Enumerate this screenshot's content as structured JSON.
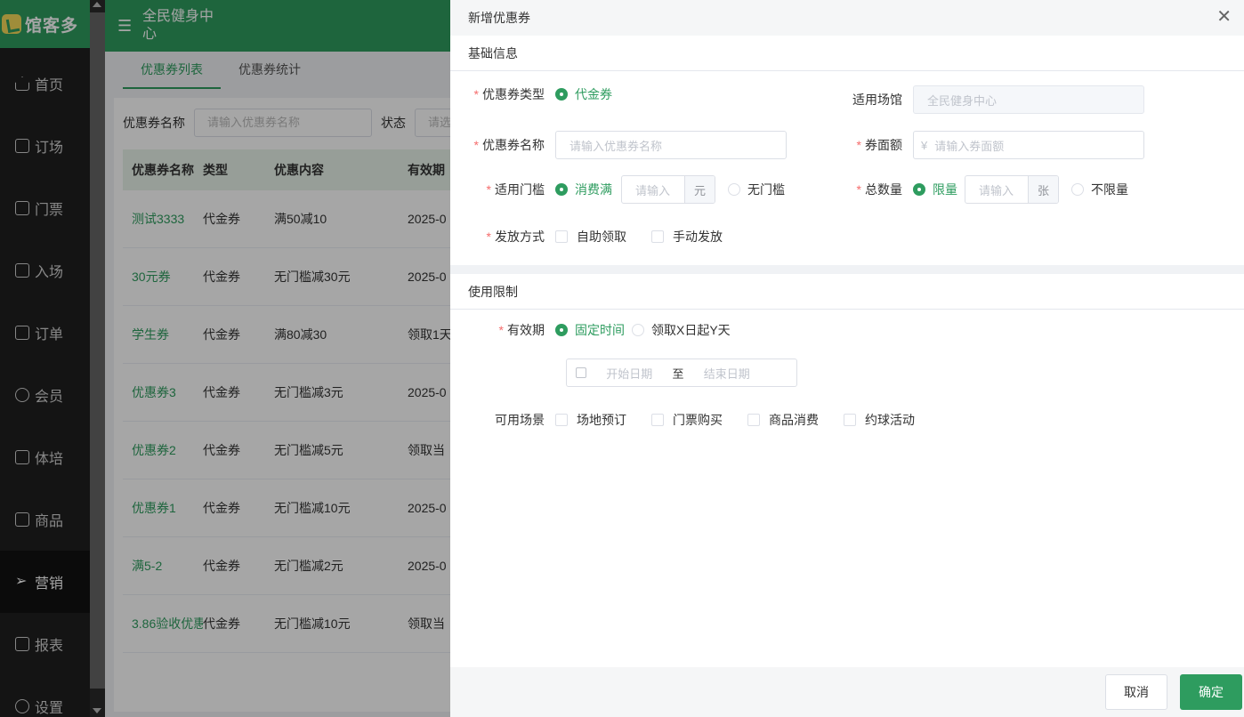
{
  "sidebar": {
    "logo": "馆客多",
    "items": [
      {
        "label": "首页"
      },
      {
        "label": "订场"
      },
      {
        "label": "门票"
      },
      {
        "label": "入场"
      },
      {
        "label": "订单"
      },
      {
        "label": "会员"
      },
      {
        "label": "体培"
      },
      {
        "label": "商品"
      },
      {
        "label": "营销"
      },
      {
        "label": "报表"
      },
      {
        "label": "设置"
      }
    ]
  },
  "header": {
    "venue": "全民健身中心"
  },
  "tabs": [
    {
      "label": "优惠券列表"
    },
    {
      "label": "优惠券统计"
    }
  ],
  "filter": {
    "name_label": "优惠券名称",
    "name_placeholder": "请输入优惠券名称",
    "status_label": "状态",
    "status_placeholder": "请选"
  },
  "table": {
    "headers": [
      "优惠券名称",
      "类型",
      "优惠内容",
      "有效期"
    ],
    "rows": [
      [
        "测试3333",
        "代金券",
        "满50减10",
        "2025-0"
      ],
      [
        "30元券",
        "代金券",
        "无门槛减30元",
        "2025-0"
      ],
      [
        "学生券",
        "代金券",
        "满80减30",
        "领取1天"
      ],
      [
        "优惠券3",
        "代金券",
        "无门槛减3元",
        "2025-0"
      ],
      [
        "优惠券2",
        "代金券",
        "无门槛减5元",
        "领取当"
      ],
      [
        "优惠券1",
        "代金券",
        "无门槛减10元",
        "2025-0"
      ],
      [
        "满5-2",
        "代金券",
        "无门槛减2元",
        "2025-0"
      ],
      [
        "3.86验收优惠",
        "代金券",
        "无门槛减10元",
        "领取当"
      ]
    ]
  },
  "drawer": {
    "title": "新增优惠券",
    "basic_section": "基础信息",
    "coupon_type_label": "优惠券类型",
    "coupon_type_value": "代金券",
    "venue_label": "适用场馆",
    "venue_value": "全民健身中心",
    "name_label": "优惠券名称",
    "name_placeholder": "请输入优惠券名称",
    "face_label": "券面额",
    "face_prefix": "¥",
    "face_placeholder": "请输入券面额",
    "threshold_label": "适用门槛",
    "threshold_on": "消费满",
    "threshold_placeholder": "请输入",
    "threshold_unit": "元",
    "threshold_off": "无门槛",
    "total_label": "总数量",
    "total_on": "限量",
    "total_placeholder": "请输入",
    "total_unit": "张",
    "total_off": "不限量",
    "issue_label": "发放方式",
    "issue_opt1": "自助领取",
    "issue_opt2": "手动发放",
    "limit_section": "使用限制",
    "validity_label": "有效期",
    "validity_opt1": "固定时间",
    "validity_opt2": "领取X日起Y天",
    "start_placeholder": "开始日期",
    "range_sep": "至",
    "end_placeholder": "结束日期",
    "scene_label": "可用场景",
    "scenes": [
      "场地预订",
      "门票购买",
      "商品消费",
      "约球活动"
    ],
    "cancel": "取消",
    "confirm": "确定"
  }
}
